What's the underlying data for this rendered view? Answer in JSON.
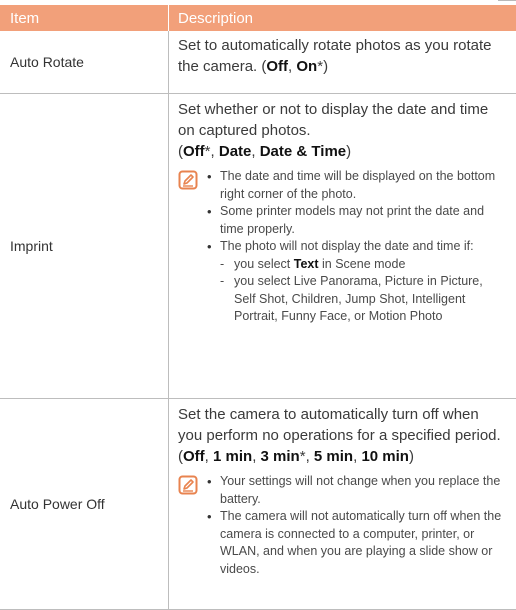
{
  "header": {
    "item": "Item",
    "description": "Description"
  },
  "rows": [
    {
      "item": "Auto Rotate",
      "desc_text": "Set to automatically rotate photos as you rotate the camera. (",
      "opt_off": "Off",
      "sep1": ", ",
      "opt_on": "On",
      "desc_end": "*)"
    },
    {
      "item": "Imprint",
      "desc_text": "Set whether or not to display the date and time on captured photos.",
      "open": "(",
      "opt_off": "Off",
      "star": "*",
      "sep1": ", ",
      "opt_date": "Date",
      "sep2": ", ",
      "opt_datetime": "Date & Time",
      "close": ")",
      "notes": [
        "The date and time will be displayed on the bottom right corner of the photo.",
        "Some printer models may not print the date and time properly.",
        "The photo will not display the date and time if:"
      ],
      "sub_notes": {
        "s1_pre": "you select ",
        "s1_bold": "Text",
        "s1_post": " in Scene mode",
        "s2": "you select Live Panorama, Picture in Picture, Self Shot, Children, Jump Shot, Intelligent Portrait, Funny Face, or Motion Photo"
      }
    },
    {
      "item": "Auto Power Off",
      "desc_text": "Set the camera to automatically turn off when you perform no operations for a specified period. (",
      "opt_off": "Off",
      "sep1": ", ",
      "opt_1min": "1 min",
      "sep2": ", ",
      "opt_3min": "3 min",
      "star": "*",
      "sep3": ", ",
      "opt_5min": "5 min",
      "sep4": ", ",
      "opt_10min": "10 min",
      "close": ")",
      "notes": [
        "Your settings will not change when you replace the battery.",
        "The camera will not automatically turn off when the camera is connected to a computer, printer, or WLAN, and when you are playing a slide show or videos."
      ]
    }
  ],
  "colors": {
    "header_bg": "#f2a07a",
    "note_icon": "#e8834f",
    "rule": "#bdbdbd"
  },
  "icons": {
    "note": "note-pencil-icon"
  }
}
